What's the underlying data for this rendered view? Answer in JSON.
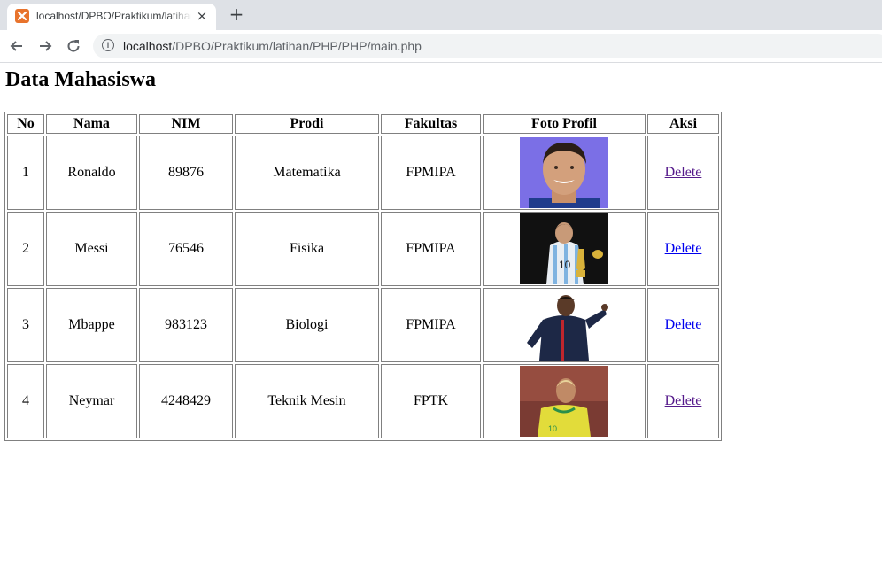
{
  "browser": {
    "tab_title": "localhost/DPBO/Praktikum/latihan/PHP/PHP/main.php",
    "close_glyph": "×",
    "new_tab_glyph": "+",
    "url_host": "localhost",
    "url_path": "/DPBO/Praktikum/latihan/PHP/PHP/main.php",
    "icons": [
      "xampp-favicon-icon",
      "close-icon",
      "plus-icon",
      "back-arrow-icon",
      "forward-arrow-icon",
      "reload-icon",
      "info-icon"
    ]
  },
  "page": {
    "title": "Data Mahasiswa",
    "headers": [
      "No",
      "Nama",
      "NIM",
      "Prodi",
      "Fakultas",
      "Foto Profil",
      "Aksi"
    ],
    "rows": [
      {
        "no": "1",
        "nama": "Ronaldo",
        "nim": "89876",
        "prodi": "Matematika",
        "fakultas": "FPMIPA",
        "aksi": "Delete",
        "visited": true
      },
      {
        "no": "2",
        "nama": "Messi",
        "nim": "76546",
        "prodi": "Fisika",
        "fakultas": "FPMIPA",
        "aksi": "Delete",
        "visited": false
      },
      {
        "no": "3",
        "nama": "Mbappe",
        "nim": "983123",
        "prodi": "Biologi",
        "fakultas": "FPMIPA",
        "aksi": "Delete",
        "visited": false
      },
      {
        "no": "4",
        "nama": "Neymar",
        "nim": "4248429",
        "prodi": "Teknik Mesin",
        "fakultas": "FPTK",
        "aksi": "Delete",
        "visited": true
      }
    ]
  },
  "colors": {
    "link": "#0000ee",
    "link_visited": "#551a8b",
    "tabstrip_bg": "#dee1e6",
    "omnibox_bg": "#f1f3f4",
    "favicon": "#e8732c"
  }
}
